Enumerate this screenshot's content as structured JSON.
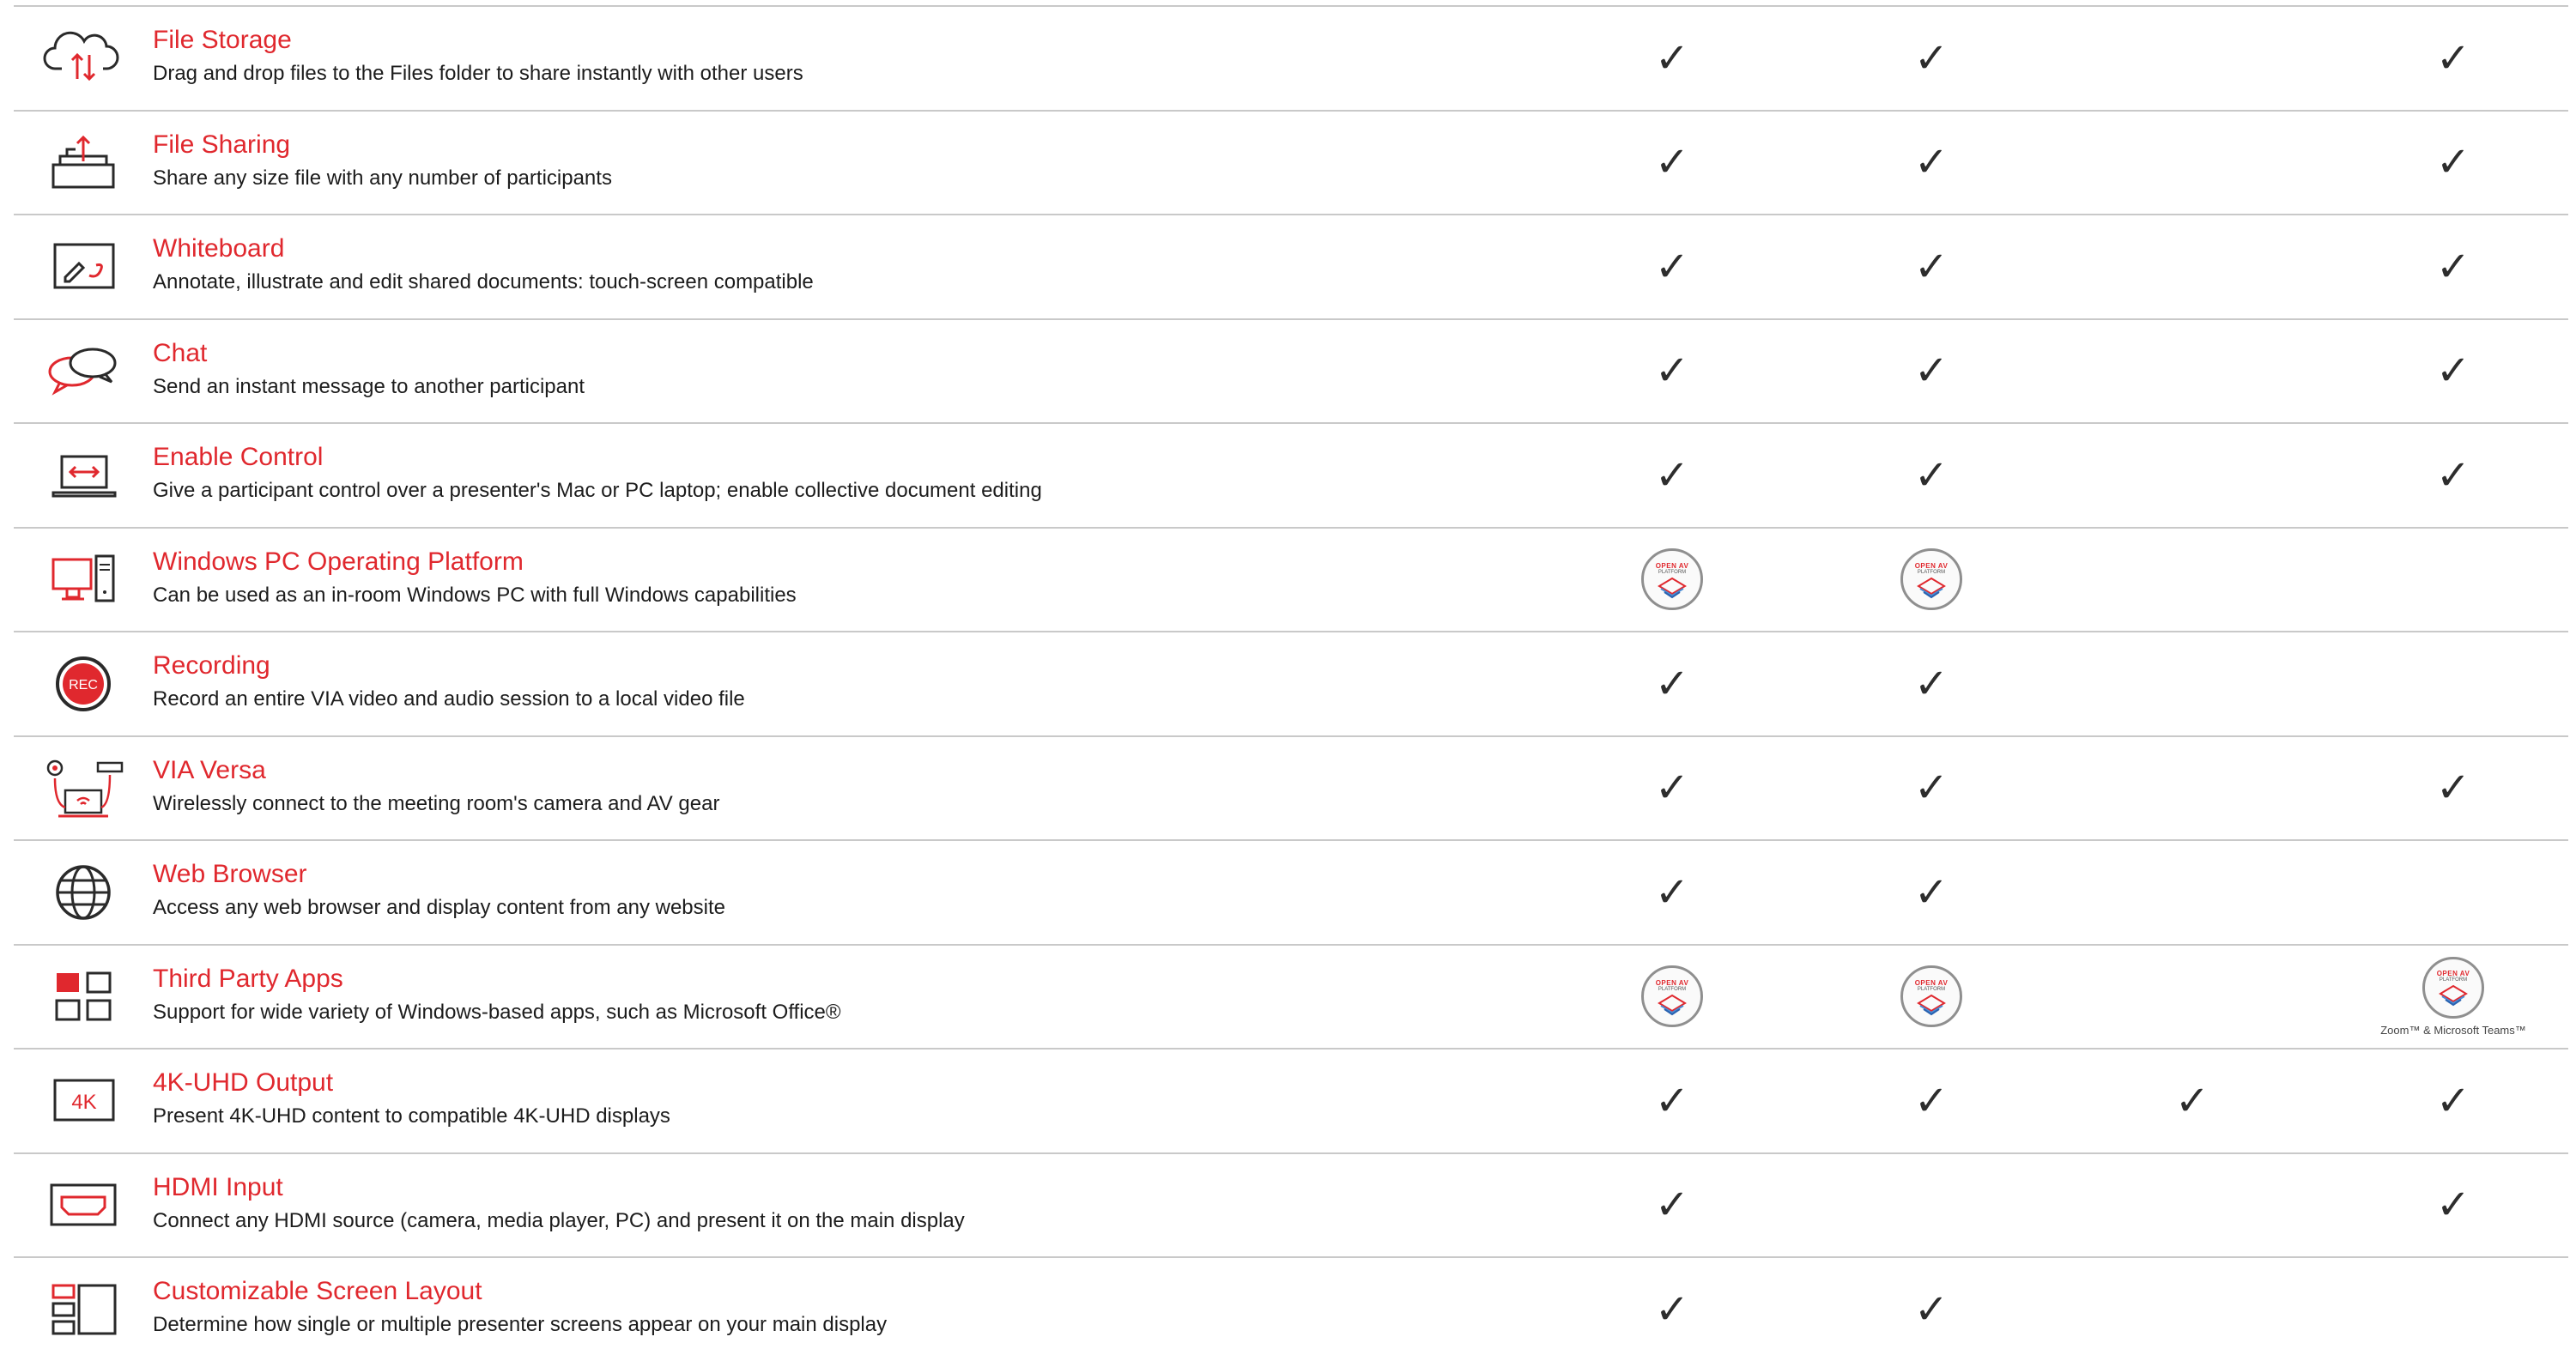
{
  "colors": {
    "accent": "#e0282e",
    "text": "#1c1c1c",
    "divider": "#c9c9c9",
    "check": "#2d2d2d"
  },
  "check_glyph": "✓",
  "badge": {
    "top": "OPEN AV",
    "sub": "PLATFORM"
  },
  "rows": [
    {
      "title": "File Storage",
      "desc": "Drag and drop files to the Files folder to share instantly with other users",
      "icon": "cloud-sync-icon",
      "cells": [
        "check",
        "check",
        "",
        "check"
      ]
    },
    {
      "title": "File Sharing",
      "desc": "Share any size file with any number of participants",
      "icon": "file-share-tray-icon",
      "cells": [
        "check",
        "check",
        "",
        "check"
      ]
    },
    {
      "title": "Whiteboard",
      "desc": "Annotate, illustrate and edit shared documents: touch-screen compatible",
      "icon": "whiteboard-icon",
      "cells": [
        "check",
        "check",
        "",
        "check"
      ]
    },
    {
      "title": "Chat",
      "desc": "Send an instant message to another participant",
      "icon": "chat-bubbles-icon",
      "cells": [
        "check",
        "check",
        "",
        "check"
      ]
    },
    {
      "title": "Enable Control",
      "desc": "Give a participant control over a presenter's Mac or PC laptop; enable collective document editing",
      "icon": "laptop-control-icon",
      "cells": [
        "check",
        "check",
        "",
        "check"
      ]
    },
    {
      "title": "Windows PC Operating Platform",
      "desc": "Can be used as an in-room Windows PC with full Windows capabilities",
      "icon": "desktop-pc-icon",
      "cells": [
        "badge",
        "badge",
        "",
        ""
      ]
    },
    {
      "title": "Recording",
      "desc": "Record an entire VIA video and audio session to a local video file",
      "icon": "rec-icon",
      "cells": [
        "check",
        "check",
        "",
        ""
      ]
    },
    {
      "title": "VIA Versa",
      "desc": "Wirelessly connect to the meeting room's camera and AV gear",
      "icon": "via-versa-icon",
      "cells": [
        "check",
        "check",
        "",
        "check"
      ]
    },
    {
      "title": "Web Browser",
      "desc": "Access any web browser and display content from any website",
      "icon": "globe-icon",
      "cells": [
        "check",
        "check",
        "",
        ""
      ]
    },
    {
      "title": "Third Party Apps",
      "desc": "Support for wide variety of Windows-based apps, such as Microsoft Office®",
      "icon": "apps-grid-icon",
      "cells": [
        "badge",
        "badge",
        "",
        "badge"
      ],
      "caption": "Zoom™ & Microsoft Teams™"
    },
    {
      "title": "4K-UHD Output",
      "desc": "Present 4K-UHD content to compatible 4K-UHD displays",
      "icon": "4k-icon",
      "icon_text": "4K",
      "cells": [
        "check",
        "check",
        "check",
        "check"
      ]
    },
    {
      "title": "HDMI Input",
      "desc": "Connect any HDMI source (camera, media player, PC) and present it on the main display",
      "icon": "hdmi-port-icon",
      "cells": [
        "check",
        "",
        "",
        "check"
      ]
    },
    {
      "title": "Customizable Screen Layout",
      "desc": "Determine how single or multiple presenter screens appear on your main display",
      "icon": "screen-layout-icon",
      "cells": [
        "check",
        "check",
        "",
        ""
      ]
    }
  ]
}
